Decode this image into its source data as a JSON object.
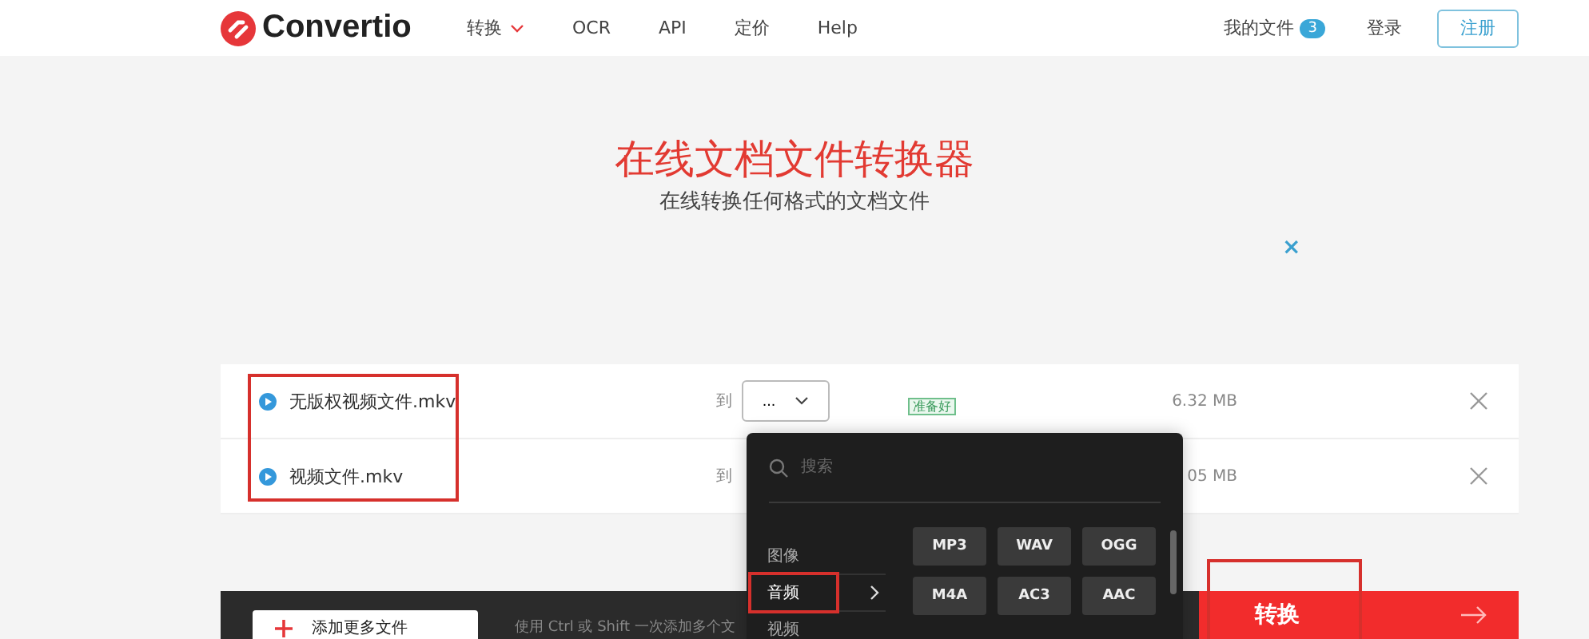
{
  "header": {
    "logo": "Convertio",
    "nav": [
      {
        "label": "转换",
        "dropdown": true
      },
      {
        "label": "OCR",
        "dropdown": false
      },
      {
        "label": "API",
        "dropdown": false
      },
      {
        "label": "定价",
        "dropdown": false
      },
      {
        "label": "Help",
        "dropdown": false
      }
    ],
    "my_files": {
      "label": "我的文件",
      "count": "3"
    },
    "login": "登录",
    "signup": "注册"
  },
  "hero": {
    "title": "在线文档文件转换器",
    "subtitle": "在线转换任何格式的文档文件",
    "ad_close": "×"
  },
  "files": [
    {
      "name": "无版权视频文件.mkv",
      "to": "到",
      "target": "...",
      "status": "准备好",
      "size": "6.32 MB"
    },
    {
      "name": "视频文件.mkv",
      "to": "到",
      "size": "05 MB"
    }
  ],
  "dropdown": {
    "placeholder": "搜索",
    "categories": [
      {
        "label": "图像",
        "selected": false
      },
      {
        "label": "音频",
        "selected": true
      },
      {
        "label": "视频",
        "selected": false
      }
    ],
    "formats": [
      "MP3",
      "WAV",
      "OGG",
      "M4A",
      "AC3",
      "AAC"
    ]
  },
  "bottom": {
    "add": "添加更多文件",
    "hint": "使用 Ctrl 或 Shift 一次添加多个文",
    "convert": "转换"
  }
}
